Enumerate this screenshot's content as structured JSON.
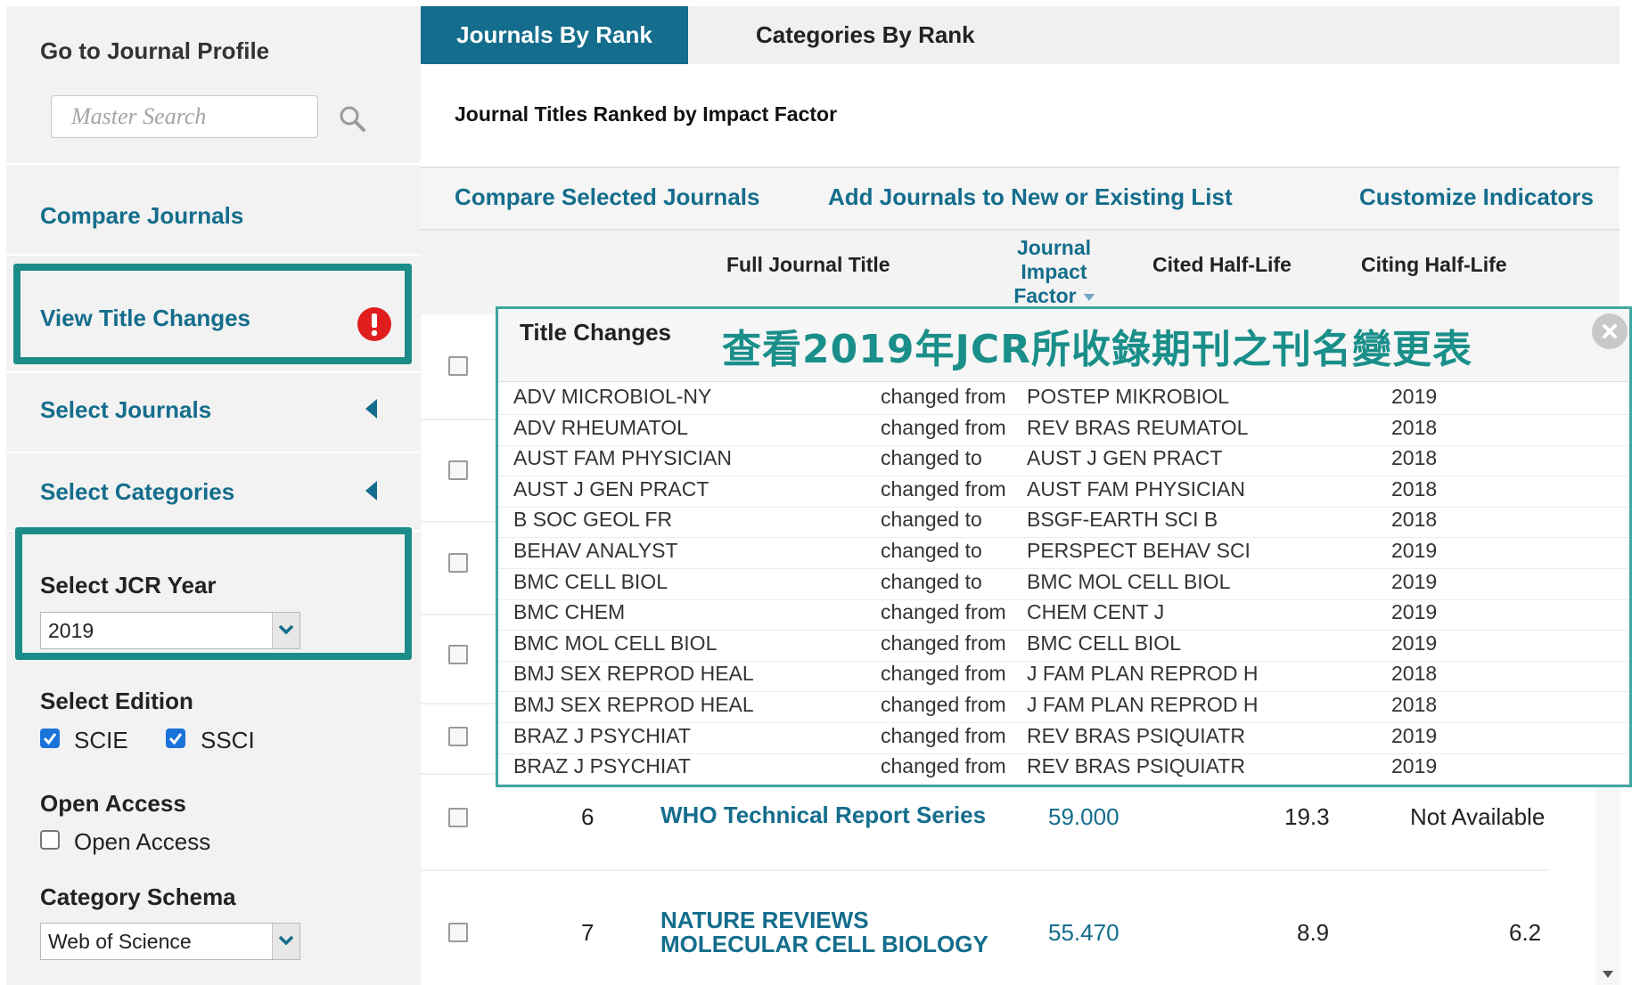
{
  "sidebar": {
    "profile_heading": "Go to Journal Profile",
    "search_placeholder": "Master Search",
    "compare_journals": "Compare Journals",
    "view_title_changes": "View Title Changes",
    "select_journals": "Select Journals",
    "select_categories": "Select Categories",
    "select_year_label": "Select JCR Year",
    "year_value": "2019",
    "edition_label": "Select Edition",
    "edition_scie": "SCIE",
    "edition_ssci": "SSCI",
    "open_access_heading": "Open Access",
    "open_access_option": "Open Access",
    "schema_label": "Category Schema",
    "schema_value": "Web of Science",
    "edition_scie_checked": true,
    "edition_ssci_checked": true,
    "open_access_checked": false,
    "highlight_color": "#1b8c88",
    "link_color": "#146d8c"
  },
  "tabs": {
    "active": "Journals By Rank",
    "inactive": "Categories By Rank"
  },
  "main": {
    "subtitle": "Journal Titles Ranked by Impact Factor",
    "actions": {
      "compare": "Compare Selected Journals",
      "add_list": "Add Journals to New or Existing List",
      "customize": "Customize Indicators"
    },
    "columns": {
      "title": "Full Journal Title",
      "jif_line1": "Journal",
      "jif_line2": "Impact",
      "jif_line3": "Factor",
      "cited": "Cited Half-Life",
      "citing": "Citing Half-Life"
    },
    "rows": [
      {
        "rank": "6",
        "title_line1": "WHO Technical Report Series",
        "title_line2": "",
        "jif": "59.000",
        "cited": "19.3",
        "citing": "Not Available"
      },
      {
        "rank": "7",
        "title_line1": "NATURE REVIEWS",
        "title_line2": "MOLECULAR CELL BIOLOGY",
        "jif": "55.470",
        "cited": "8.9",
        "citing": "6.2"
      }
    ]
  },
  "popup": {
    "title": "Title Changes",
    "caption": "查看2019年JCR所收錄期刊之刊名變更表",
    "rows": [
      {
        "journal": "ADV MICROBIOL-NY",
        "change": "changed from",
        "other": "POSTEP MIKROBIOL",
        "year": "2019"
      },
      {
        "journal": "ADV RHEUMATOL",
        "change": "changed from",
        "other": "REV BRAS REUMATOL",
        "year": "2018"
      },
      {
        "journal": "AUST FAM PHYSICIAN",
        "change": "changed to",
        "other": "AUST J GEN PRACT",
        "year": "2018"
      },
      {
        "journal": "AUST J GEN PRACT",
        "change": "changed from",
        "other": "AUST FAM PHYSICIAN",
        "year": "2018"
      },
      {
        "journal": "B SOC GEOL FR",
        "change": "changed to",
        "other": "BSGF-EARTH SCI B",
        "year": "2018"
      },
      {
        "journal": "BEHAV ANALYST",
        "change": "changed to",
        "other": "PERSPECT BEHAV SCI",
        "year": "2019"
      },
      {
        "journal": "BMC CELL BIOL",
        "change": "changed to",
        "other": "BMC MOL CELL BIOL",
        "year": "2019"
      },
      {
        "journal": "BMC CHEM",
        "change": "changed from",
        "other": "CHEM CENT J",
        "year": "2019"
      },
      {
        "journal": "BMC MOL CELL BIOL",
        "change": "changed from",
        "other": "BMC CELL BIOL",
        "year": "2019"
      },
      {
        "journal": "BMJ SEX REPROD HEAL",
        "change": "changed from",
        "other": "J FAM PLAN REPROD H",
        "year": "2018"
      },
      {
        "journal": "BMJ SEX REPROD HEAL",
        "change": "changed from",
        "other": "J FAM PLAN REPROD H",
        "year": "2018"
      },
      {
        "journal": "BRAZ J PSYCHIAT",
        "change": "changed from",
        "other": "REV BRAS PSIQUIATR",
        "year": "2019"
      },
      {
        "journal": "BRAZ J PSYCHIAT",
        "change": "changed from",
        "other": "REV BRAS PSIQUIATR",
        "year": "2019"
      }
    ]
  },
  "icons": {
    "search": "search-icon",
    "alert": "exclamation-icon",
    "collapse": "triangle-left-icon",
    "close": "close-icon",
    "dropdown": "chevron-down-icon",
    "sort": "sort-down-icon"
  }
}
